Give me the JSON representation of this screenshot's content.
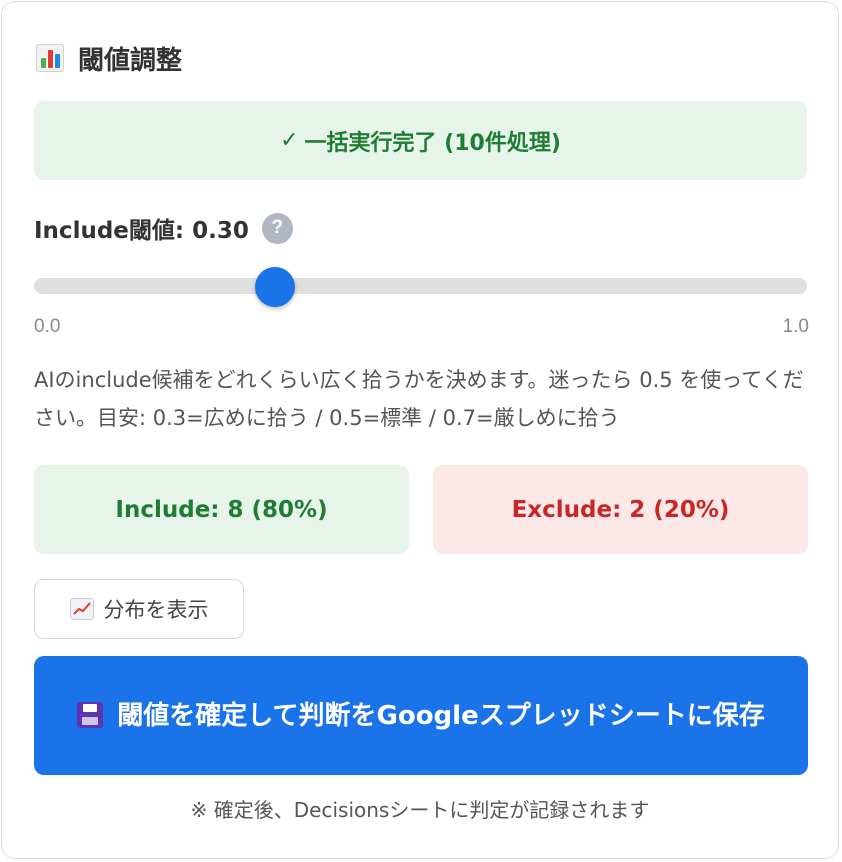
{
  "header": {
    "icon": "bar-chart-icon",
    "title": "閾値調整"
  },
  "status": {
    "check_glyph": "✓",
    "message": "一括実行完了 (10件処理)",
    "color": "#1e7d32",
    "background": "#e6f4ea"
  },
  "threshold": {
    "label": "Include閾値: 0.30",
    "value": 0.3,
    "min_label": "0.0",
    "max_label": "1.0",
    "help_glyph": "?",
    "accent_color": "#1a73e8"
  },
  "description": "AIのinclude候補をどれくらい広く拾うかを決めます。迷ったら 0.5 を使ってください。目安: 0.3=広めに拾う / 0.5=標準 / 0.7=厳しめに拾う",
  "stats": {
    "include_text": "Include: 8 (80%)",
    "exclude_text": "Exclude: 2 (20%)",
    "include_color": "#1e7d32",
    "exclude_color": "#c62828"
  },
  "actions": {
    "distribution_label": "分布を表示",
    "distribution_icon": "trend-chart-icon",
    "save_label": "閾値を確定して判断をGoogleスプレッドシートに保存",
    "save_icon": "floppy-disk-icon"
  },
  "footer_note": "※ 確定後、Decisionsシートに判定が記録されます"
}
